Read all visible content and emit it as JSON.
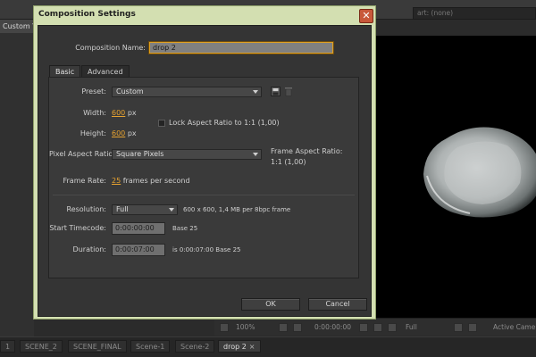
{
  "background": {
    "top_field_text": "art: (none)",
    "custom_tab": "Custom V",
    "viewer_bar": {
      "zoom": "100%",
      "timecode": "0:00:00:00",
      "resolution": "Full",
      "camera": "Active Came"
    },
    "timeline_tabs": [
      {
        "label": "1",
        "active": false
      },
      {
        "label": "SCENE_2",
        "active": false
      },
      {
        "label": "SCENE_FINAL",
        "active": false
      },
      {
        "label": "Scene-1",
        "active": false
      },
      {
        "label": "Scene-2",
        "active": false
      },
      {
        "label": "drop 2",
        "active": true
      }
    ]
  },
  "dialog": {
    "title": "Composition Settings",
    "composition_name_label": "Composition Name:",
    "composition_name_value": "drop 2",
    "tabs": [
      {
        "label": "Basic",
        "active": true
      },
      {
        "label": "Advanced",
        "active": false
      }
    ],
    "basic": {
      "preset_label": "Preset:",
      "preset_value": "Custom",
      "width_label": "Width:",
      "width_value": "600",
      "height_label": "Height:",
      "height_value": "600",
      "unit_px": "px",
      "lock_aspect_label": "Lock Aspect Ratio to 1:1 (1,00)",
      "lock_aspect_checked": false,
      "pixel_aspect_label": "Pixel Aspect Ratio:",
      "pixel_aspect_value": "Square Pixels",
      "frame_aspect_label": "Frame Aspect Ratio:",
      "frame_aspect_value": "1:1 (1,00)",
      "frame_rate_label": "Frame Rate:",
      "frame_rate_value": "25",
      "frame_rate_unit": "frames per second",
      "resolution_label": "Resolution:",
      "resolution_value": "Full",
      "resolution_info": "600 x 600, 1,4 MB per 8bpc frame",
      "start_timecode_label": "Start Timecode:",
      "start_timecode_value": "0:00:00:00",
      "start_base": "Base 25",
      "duration_label": "Duration:",
      "duration_value": "0:00:07:00",
      "duration_info": "is 0:00:07:00  Base 25"
    },
    "ok_label": "OK",
    "cancel_label": "Cancel"
  }
}
